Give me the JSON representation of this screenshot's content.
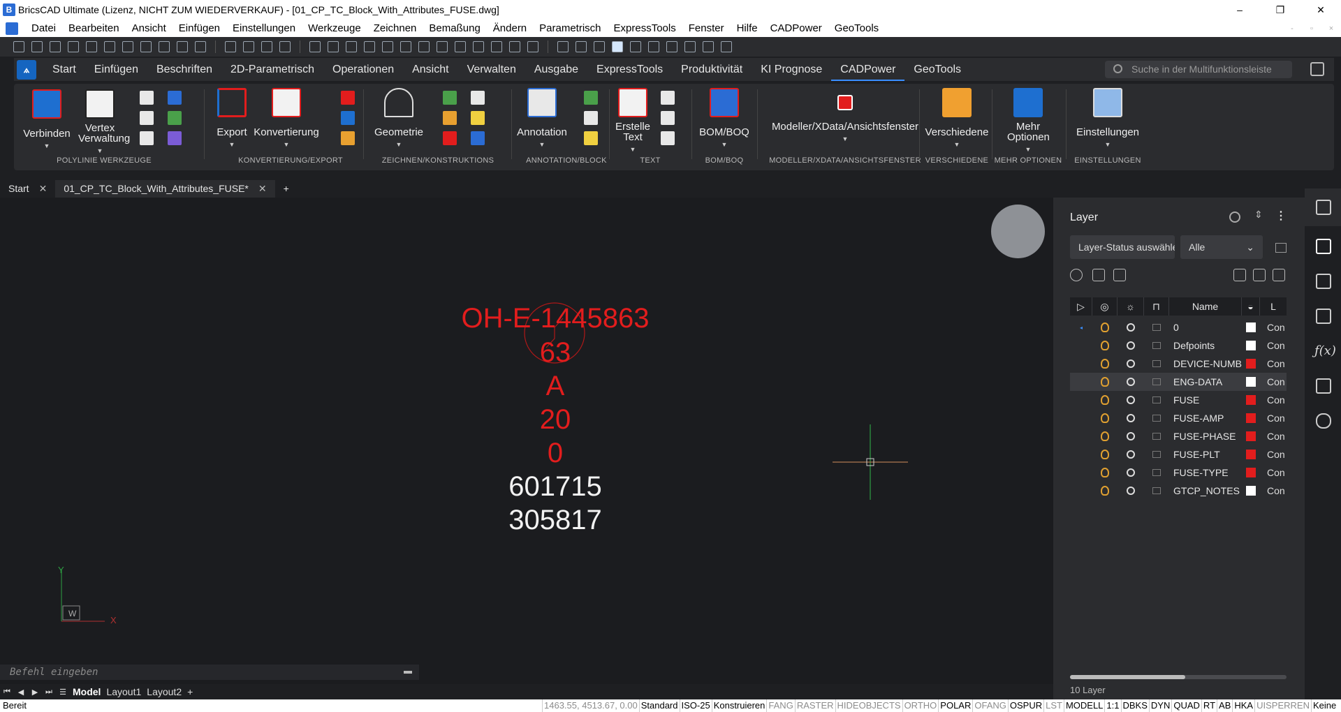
{
  "window": {
    "title": "BricsCAD Ultimate (Lizenz, NICHT ZUM WIEDERVERKAUF) - [01_CP_TC_Block_With_Attributes_FUSE.dwg]",
    "controls": [
      "–",
      "❐",
      "✕"
    ]
  },
  "menubar": {
    "items": [
      "Datei",
      "Bearbeiten",
      "Ansicht",
      "Einfügen",
      "Einstellungen",
      "Werkzeuge",
      "Zeichnen",
      "Bemaßung",
      "Ändern",
      "Parametrisch",
      "ExpressTools",
      "Fenster",
      "Hilfe",
      "CADPower",
      "GeoTools"
    ],
    "doc_controls": [
      "-",
      "▫",
      "×"
    ]
  },
  "ribbon_tabs": {
    "items": [
      "Start",
      "Einfügen",
      "Beschriften",
      "2D-Parametrisch",
      "Operationen",
      "Ansicht",
      "Verwalten",
      "Ausgabe",
      "ExpressTools",
      "Produktivität",
      "KI Prognose",
      "CADPower",
      "GeoTools"
    ],
    "active": "CADPower",
    "search_placeholder": "Suche in der Multifunktionsleiste"
  },
  "ribbon": {
    "panels": [
      {
        "label": "POLYLINIE WERKZEUGE",
        "buttons": [
          "Verbinden",
          "Vertex Verwaltung"
        ]
      },
      {
        "label": "KONVERTIERUNG/EXPORT",
        "buttons": [
          "Export",
          "Konvertierung"
        ]
      },
      {
        "label": "ZEICHNEN/KONSTRUKTIONS",
        "buttons": [
          "Geometrie"
        ]
      },
      {
        "label": "ANNOTATION/BLOCK",
        "buttons": [
          "Annotation"
        ]
      },
      {
        "label": "TEXT",
        "buttons": [
          "Erstelle Text"
        ]
      },
      {
        "label": "BOM/BOQ",
        "buttons": [
          "BOM/BOQ"
        ]
      },
      {
        "label": "MODELLER/XDATA/ANSICHTSFENSTER",
        "buttons": [
          "Modeller/XData/Ansichtsfenster"
        ]
      },
      {
        "label": "VERSCHIEDENE",
        "buttons": [
          "Verschiedene"
        ]
      },
      {
        "label": "MEHR OPTIONEN",
        "buttons": [
          "Mehr Optionen"
        ]
      },
      {
        "label": "EINSTELLUNGEN",
        "buttons": [
          "Einstellungen"
        ]
      }
    ],
    "colors": {
      "blue": "#1565c0",
      "red": "#e21d1d",
      "orange": "#f0a030"
    }
  },
  "doc_tabs": [
    {
      "label": "Start"
    },
    {
      "label": "01_CP_TC_Block_With_Attributes_FUSE*"
    }
  ],
  "drawing": {
    "attributes_red": [
      "OH-E-1445863",
      "63",
      "A",
      "20",
      "0"
    ],
    "attributes_white": [
      "601715",
      "305817"
    ],
    "ucs": {
      "y": "Y",
      "x": "X",
      "w": "W"
    },
    "colors": {
      "attribute": "#e21d1d",
      "circle": "#b01818",
      "crosshair_v": "#2ea043",
      "crosshair_h": "#b07a50"
    }
  },
  "command_line": {
    "placeholder": "Befehl eingeben"
  },
  "layout_tabs": [
    "Model",
    "Layout1",
    "Layout2",
    "+"
  ],
  "statusbar": {
    "ready": "Bereit",
    "coords": "1463.55, 4513.67, 0.00",
    "items": [
      {
        "label": "Standard",
        "on": true
      },
      {
        "label": "ISO-25",
        "on": true
      },
      {
        "label": "Konstruieren",
        "on": true
      },
      {
        "label": "FANG",
        "on": false
      },
      {
        "label": "RASTER",
        "on": false
      },
      {
        "label": "HIDEOBJECTS",
        "on": false
      },
      {
        "label": "ORTHO",
        "on": false
      },
      {
        "label": "POLAR",
        "on": true
      },
      {
        "label": "OFANG",
        "on": false
      },
      {
        "label": "OSPUR",
        "on": true
      },
      {
        "label": "LST",
        "on": false
      },
      {
        "label": "MODELL",
        "on": true
      },
      {
        "label": "1:1",
        "on": true
      },
      {
        "label": "DBKS",
        "on": true
      },
      {
        "label": "DYN",
        "on": true
      },
      {
        "label": "QUAD",
        "on": true
      },
      {
        "label": "RT",
        "on": true
      },
      {
        "label": "AB",
        "on": true
      },
      {
        "label": "HKA",
        "on": true
      },
      {
        "label": "UISPERREN",
        "on": false
      },
      {
        "label": "Keine",
        "on": true
      }
    ]
  },
  "layer_panel": {
    "title": "Layer",
    "status_select": "Layer-Status auswähle",
    "filter_select": "Alle",
    "columns": {
      "name": "Name",
      "linetype": "L"
    },
    "rows": [
      {
        "name": "0",
        "color": "#ffffff",
        "linetype": "Con",
        "current": true,
        "selected": false
      },
      {
        "name": "Defpoints",
        "color": "#ffffff",
        "linetype": "Con",
        "current": false,
        "selected": false
      },
      {
        "name": "DEVICE-NUMB",
        "color": "#e21d1d",
        "linetype": "Con",
        "current": false,
        "selected": false
      },
      {
        "name": "ENG-DATA",
        "color": "#ffffff",
        "linetype": "Con",
        "current": false,
        "selected": true
      },
      {
        "name": "FUSE",
        "color": "#e21d1d",
        "linetype": "Con",
        "current": false,
        "selected": false
      },
      {
        "name": "FUSE-AMP",
        "color": "#e21d1d",
        "linetype": "Con",
        "current": false,
        "selected": false
      },
      {
        "name": "FUSE-PHASE",
        "color": "#e21d1d",
        "linetype": "Con",
        "current": false,
        "selected": false
      },
      {
        "name": "FUSE-PLT",
        "color": "#e21d1d",
        "linetype": "Con",
        "current": false,
        "selected": false
      },
      {
        "name": "FUSE-TYPE",
        "color": "#e21d1d",
        "linetype": "Con",
        "current": false,
        "selected": false
      },
      {
        "name": "GTCP_NOTES",
        "color": "#ffffff",
        "linetype": "Con",
        "current": false,
        "selected": false
      }
    ],
    "count": "10 Layer"
  }
}
